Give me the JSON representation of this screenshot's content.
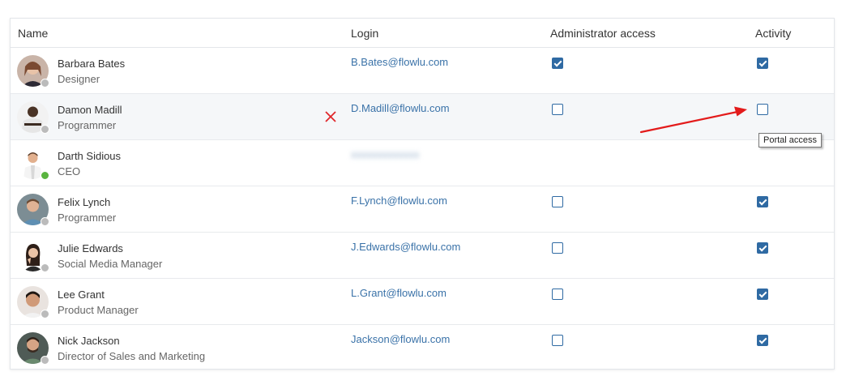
{
  "table": {
    "columns": {
      "name": "Name",
      "login": "Login",
      "admin": "Administrator access",
      "activity": "Activity"
    },
    "rows": [
      {
        "name": "Barbara Bates",
        "role": "Designer",
        "login": "B.Bates@flowlu.com",
        "admin": true,
        "activity": true,
        "status": "offline",
        "avatar_color": "#b8776a"
      },
      {
        "name": "Damon Madill",
        "role": "Programmer",
        "login": "D.Madill@flowlu.com",
        "admin": false,
        "activity": false,
        "status": "offline",
        "avatar_color": "#4a3a30"
      },
      {
        "name": "Darth Sidious",
        "role": "CEO",
        "login": "",
        "admin": null,
        "activity": null,
        "status": "online",
        "avatar_color": "#d9a889"
      },
      {
        "name": "Felix Lynch",
        "role": "Programmer",
        "login": "F.Lynch@flowlu.com",
        "admin": false,
        "activity": true,
        "status": "offline",
        "avatar_color": "#6f8a96"
      },
      {
        "name": "Julie Edwards",
        "role": "Social Media Manager",
        "login": "J.Edwards@flowlu.com",
        "admin": false,
        "activity": true,
        "status": "offline",
        "avatar_color": "#3b2a22"
      },
      {
        "name": "Lee Grant",
        "role": "Product Manager",
        "login": "L.Grant@flowlu.com",
        "admin": false,
        "activity": true,
        "status": "offline",
        "avatar_color": "#c69a7c"
      },
      {
        "name": "Nick Jackson",
        "role": "Director of Sales and Marketing",
        "login": "Jackson@flowlu.com",
        "admin": false,
        "activity": true,
        "status": "offline",
        "avatar_color": "#4d5a52"
      }
    ]
  },
  "tooltip": {
    "text": "Portal access"
  },
  "colors": {
    "accent": "#2f6aa3",
    "link": "#3a72a8",
    "online": "#59b43f",
    "offline": "#bbbbbb",
    "delete": "#e0262a",
    "arrow": "#e31b1b"
  },
  "icons": {
    "delete": "close-icon",
    "annotation": "arrow-icon"
  }
}
